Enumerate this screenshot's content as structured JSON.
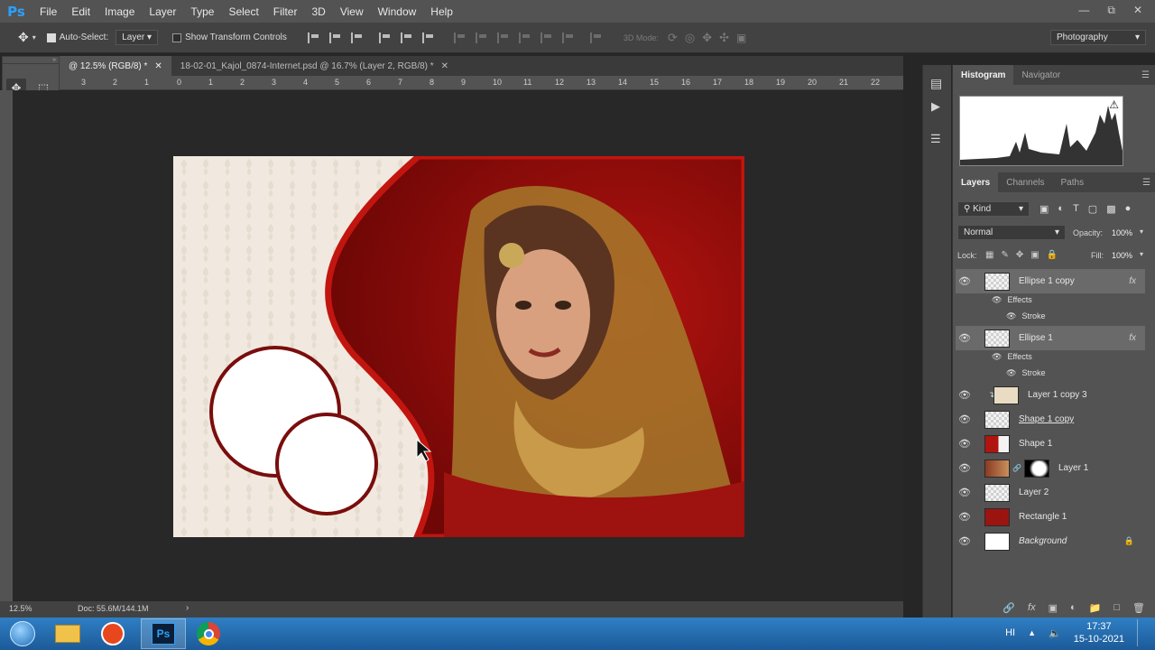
{
  "app": {
    "logo": "Ps"
  },
  "menu": [
    "File",
    "Edit",
    "Image",
    "Layer",
    "Type",
    "Select",
    "Filter",
    "3D",
    "View",
    "Window",
    "Help"
  ],
  "window_controls": [
    "minimize-icon",
    "restore-icon",
    "close-icon"
  ],
  "options": {
    "auto_select_label": "Auto-Select:",
    "auto_select_checked": true,
    "auto_select_target": "Layer",
    "show_transform_label": "Show Transform Controls",
    "show_transform_checked": false,
    "mode_3d_label": "3D Mode:",
    "workspace": "Photography"
  },
  "tabs": [
    {
      "label": "@ 12.5% (RGB/8) *",
      "active": true
    },
    {
      "label": "18-02-01_Kajol_0874-Internet.psd @ 16.7% (Layer 2, RGB/8) *",
      "active": false
    }
  ],
  "ruler": [
    "3",
    "2",
    "1",
    "0",
    "1",
    "2",
    "3",
    "4",
    "5",
    "6",
    "7",
    "8",
    "9",
    "10",
    "11",
    "12",
    "13",
    "14",
    "15",
    "16",
    "17",
    "18",
    "19",
    "20",
    "21",
    "22"
  ],
  "status": {
    "zoom": "12.5%",
    "doc": "Doc: 55.6M/144.1M"
  },
  "top_panel": {
    "tabs": [
      "Histogram",
      "Navigator"
    ]
  },
  "layers_panel": {
    "tabs": [
      "Layers",
      "Channels",
      "Paths"
    ],
    "filter": "Kind",
    "blend_mode": "Normal",
    "opacity_label": "Opacity:",
    "opacity": "100%",
    "lock_label": "Lock:",
    "fill_label": "Fill:",
    "fill": "100%",
    "effects_label": "Effects",
    "stroke_label": "Stroke",
    "layers": [
      {
        "name": "Ellipse 1 copy",
        "fx": "fx",
        "thumb": "shape",
        "highlight": true
      },
      {
        "name": "Ellipse 1",
        "fx": "fx",
        "thumb": "shape",
        "highlight": true
      },
      {
        "name": "Layer 1 copy 3",
        "thumb": "pattern"
      },
      {
        "name": "Shape 1 copy",
        "thumb": "shape"
      },
      {
        "name": "Shape 1",
        "thumb": "red-shape"
      },
      {
        "name": "Layer 1",
        "thumb": "photo"
      },
      {
        "name": "Layer 2",
        "thumb": "empty"
      },
      {
        "name": "Rectangle 1",
        "thumb": "red"
      },
      {
        "name": "Background",
        "thumb": "white",
        "locked": true
      }
    ]
  },
  "taskbar": {
    "apps": [
      "start-orb-icon",
      "file-explorer-icon",
      "media-app-icon",
      "photoshop-icon",
      "chrome-icon"
    ],
    "ps_label": "Ps",
    "lang": "HI",
    "time": "17:37",
    "date": "15-10-2021"
  },
  "colors": {
    "accent_blue": "#2aa1ff",
    "crimson": "#a30d0d",
    "stroke_dark_red": "#7a0d0d",
    "cream": "#efe7dc"
  }
}
